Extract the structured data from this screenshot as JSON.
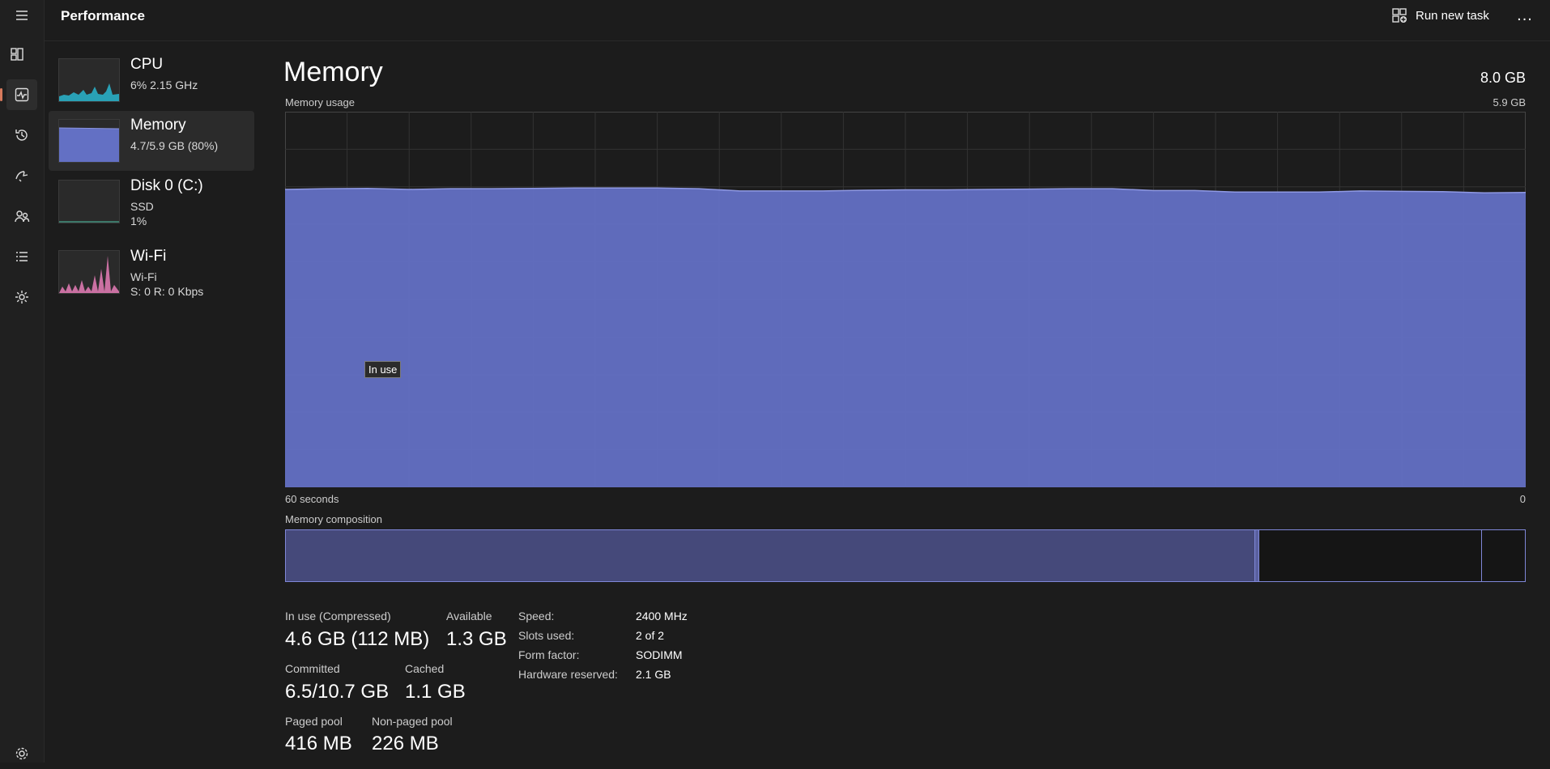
{
  "app": {
    "title": "Performance"
  },
  "toolbar": {
    "run_new_task_label": "Run new task",
    "more_label": "..."
  },
  "nav": [
    {
      "name": "hamburger-menu-icon",
      "active": false
    },
    {
      "name": "processes-icon",
      "active": false
    },
    {
      "name": "performance-icon",
      "active": true
    },
    {
      "name": "app-history-icon",
      "active": false
    },
    {
      "name": "startup-apps-icon",
      "active": false
    },
    {
      "name": "users-icon",
      "active": false
    },
    {
      "name": "details-icon",
      "active": false
    },
    {
      "name": "services-icon",
      "active": false
    },
    {
      "name": "settings-icon",
      "active": false
    }
  ],
  "resources": [
    {
      "title": "CPU",
      "line1": "6%  2.15 GHz",
      "line2": "",
      "color": "#29b6cf",
      "selected": false
    },
    {
      "title": "Memory",
      "line1": "4.7/5.9 GB (80%)",
      "line2": "",
      "color": "#7481d1",
      "selected": true
    },
    {
      "title": "Disk 0 (C:)",
      "line1": "SSD",
      "line2": "1%",
      "color": "#4fc7a8",
      "selected": false
    },
    {
      "title": "Wi-Fi",
      "line1": "Wi-Fi",
      "line2": "S: 0 R: 0 Kbps",
      "color": "#e67db7",
      "selected": false
    }
  ],
  "memory": {
    "title": "Memory",
    "total": "8.0 GB",
    "usage_label": "Memory usage",
    "usage_max": "5.9 GB",
    "time_label": "60 seconds",
    "time_end": "0",
    "tooltip": "In use",
    "composition_label": "Memory composition",
    "composition": [
      {
        "name": "in-use",
        "fraction": 0.782,
        "color": "#45497a"
      },
      {
        "name": "modified",
        "fraction": 0.003,
        "color": "#5a60a0"
      },
      {
        "name": "standby",
        "fraction": 0.18,
        "color": "#151515"
      },
      {
        "name": "free",
        "fraction": 0.035,
        "color": "#151515"
      }
    ],
    "stats": {
      "in_use_label": "In use (Compressed)",
      "in_use_value": "4.6 GB (112 MB)",
      "available_label": "Available",
      "available_value": "1.3 GB",
      "committed_label": "Committed",
      "committed_value": "6.5/10.7 GB",
      "cached_label": "Cached",
      "cached_value": "1.1 GB",
      "paged_label": "Paged pool",
      "paged_value": "416 MB",
      "nonpaged_label": "Non-paged pool",
      "nonpaged_value": "226 MB"
    },
    "specs": {
      "speed_label": "Speed:",
      "speed_value": "2400 MHz",
      "slots_label": "Slots used:",
      "slots_value": "2 of 2",
      "form_label": "Form factor:",
      "form_value": "SODIMM",
      "hw_label": "Hardware reserved:",
      "hw_value": "2.1 GB"
    },
    "usage_series": [
      0.793,
      0.795,
      0.796,
      0.793,
      0.795,
      0.795,
      0.796,
      0.797,
      0.797,
      0.797,
      0.795,
      0.789,
      0.789,
      0.789,
      0.791,
      0.792,
      0.792,
      0.793,
      0.794,
      0.795,
      0.795,
      0.79,
      0.79,
      0.786,
      0.786,
      0.786,
      0.789,
      0.788,
      0.787,
      0.784,
      0.785
    ]
  }
}
